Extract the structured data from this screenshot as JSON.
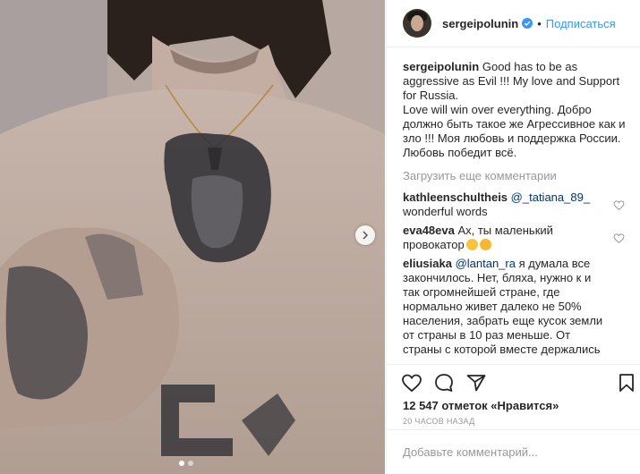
{
  "header": {
    "username": "sergeipolunin",
    "separator": "•",
    "follow_label": "Подписаться"
  },
  "caption": {
    "username": "sergeipolunin",
    "lines": [
      " Good has to be as",
      "aggressive as Evil !!! My love and Support",
      "for Russia.",
      "Love will win over everything. Добро",
      "должно быть такое же Агрессивное как и",
      "зло !!! Моя любовь и поддержка России.",
      "Любовь победит всё."
    ]
  },
  "load_more_label": "Загрузить еще комментарии",
  "comments": [
    {
      "username": "kathleenschultheis",
      "mention": "@_tatiana_89_",
      "text": "wonderful words"
    },
    {
      "username": "eva48eva",
      "text_line1": " Ах, ты маленький",
      "text_line2": "провокатор"
    },
    {
      "username": "eliusiaka",
      "mention": "@lantan_ra",
      "text_line1": " я думала все",
      "lines": [
        "закончилось. Нет, бляха, нужно к и",
        "так огромнейшей стране, где",
        "нормально живет далеко не 50%",
        "населения, забрать еще кусок земли",
        "от страны в 10 раз меньше. От",
        "страны с которой вместе держались"
      ]
    }
  ],
  "likes_text": "12 547 отметок «Нравится»",
  "timestamp": "20 ЧАСОВ НАЗАД",
  "add_comment_placeholder": "Добавьте комментарий...",
  "colors": {
    "link": "#3897f0",
    "mention": "#003569",
    "muted": "#999999",
    "border": "#efefef"
  },
  "icons": [
    "heart-icon",
    "comment-icon",
    "share-icon",
    "bookmark-icon",
    "verified-badge-icon",
    "next-arrow-icon"
  ]
}
